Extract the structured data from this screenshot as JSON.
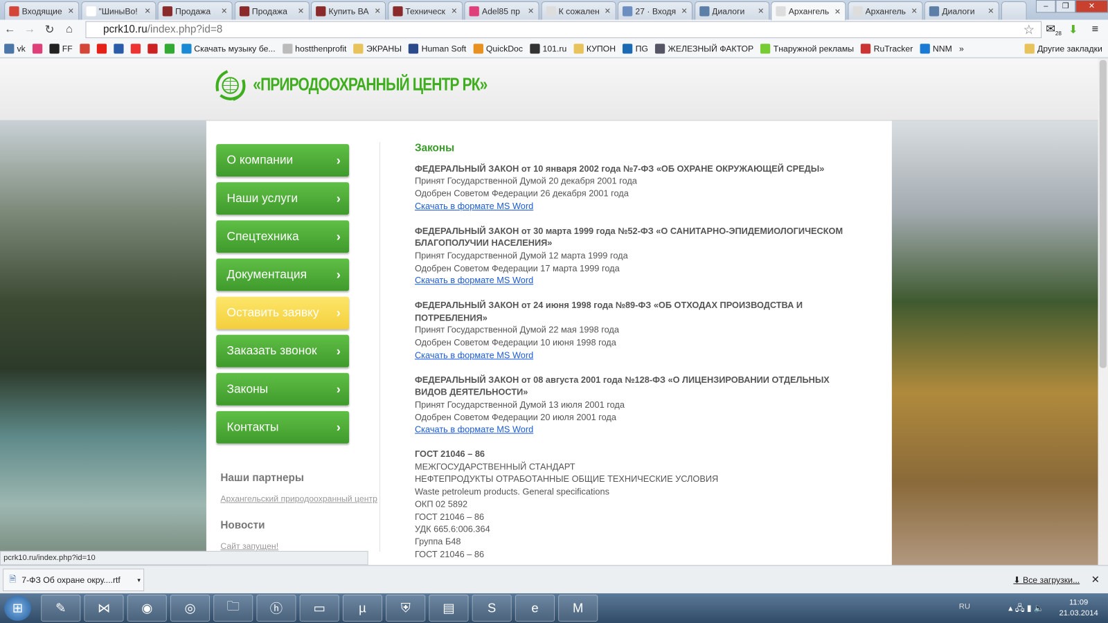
{
  "browser": {
    "tabs": [
      {
        "title": "Входящие",
        "icon": "gmail-icon",
        "color": "#d44638"
      },
      {
        "title": "\"ШиныВо!",
        "icon": "blank-page-icon",
        "color": "#ffffff"
      },
      {
        "title": "Продажа",
        "icon": "car-icon",
        "color": "#8b2a2a"
      },
      {
        "title": "Продажа",
        "icon": "car-icon",
        "color": "#8b2a2a"
      },
      {
        "title": "Купить ВА",
        "icon": "car-icon",
        "color": "#8b2a2a"
      },
      {
        "title": "Техническ",
        "icon": "car-icon",
        "color": "#8b2a2a"
      },
      {
        "title": "Adel85 пр",
        "icon": "heart-icon",
        "color": "#e0407a"
      },
      {
        "title": "К сожален",
        "icon": "page-icon",
        "color": "#dddddd"
      },
      {
        "title": "27 · Входя",
        "icon": "mail-icon",
        "color": "#6a8fc0"
      },
      {
        "title": "Диалоги",
        "icon": "vk-chat-icon",
        "color": "#5b7fa6"
      },
      {
        "title": "Архангель",
        "icon": "page-icon",
        "color": "#dddddd"
      },
      {
        "title": "Архангель",
        "icon": "page-icon",
        "color": "#dddddd"
      },
      {
        "title": "Диалоги",
        "icon": "vk-chat-icon",
        "color": "#5b7fa6"
      }
    ],
    "active_tab": 10,
    "url_host": "pcrk10.ru",
    "url_path": "/index.php?id=8",
    "mail_badge": "28",
    "bookmarks": [
      "vk",
      "",
      "FF",
      "",
      "",
      "",
      "",
      "",
      "",
      "Скачать музыку бе...",
      "hostthenprofit",
      "ЭКРАНЫ",
      "Human Soft",
      "QuickDoc",
      "101.ru",
      "КУПОН",
      "ПG",
      "ЖЕЛЕЗНЫЙ ФАКТОР",
      "Тнаружной рекламы",
      "RuTracker",
      "NNM"
    ],
    "more": "»",
    "other_bookmarks": "Другие закладки",
    "status_url": "pcrk10.ru/index.php?id=10"
  },
  "site": {
    "logo": "«ПРИРОДООХРАННЫЙ ЦЕНТР РК»",
    "menu": [
      "О компании",
      "Наши услуги",
      "Спецтехника",
      "Документация",
      "Оставить заявку",
      "Заказать звонок",
      "Законы",
      "Контакты"
    ],
    "partners_title": "Наши партнеры",
    "partner_link": "Архангельский природоохранный центр",
    "news_title": "Новости",
    "news_link": "Сайт запущен!",
    "heading": "Законы",
    "laws": [
      {
        "title": "ФЕДЕРАЛЬНЫЙ ЗАКОН от 10 января 2002 года №7-ФЗ «ОБ ОХРАНЕ ОКРУЖАЮЩЕЙ СРЕДЫ»",
        "adopted": "Принят Государственной Думой 20 декабря 2001 года",
        "approved": "Одобрен Советом Федерации 26 декабря 2001 года",
        "link": "Скачать в формате MS Word"
      },
      {
        "title": "ФЕДЕРАЛЬНЫЙ ЗАКОН от 30 марта 1999 года №52-ФЗ «О САНИТАРНО-ЭПИДЕМИОЛОГИЧЕСКОМ БЛАГОПОЛУЧИИ НАСЕЛЕНИЯ»",
        "adopted": "Принят Государственной Думой 12 марта 1999 года",
        "approved": "Одобрен Советом Федерации 17 марта 1999 года",
        "link": "Скачать в формате MS Word"
      },
      {
        "title": "ФЕДЕРАЛЬНЫЙ ЗАКОН от 24 июня 1998 года №89-ФЗ «ОБ ОТХОДАХ ПРОИЗВОДСТВА И ПОТРЕБЛЕНИЯ»",
        "adopted": "Принят Государственной Думой 22 мая 1998 года",
        "approved": "Одобрен Советом Федерации 10 июня 1998 года",
        "link": "Скачать в формате MS Word"
      },
      {
        "title": "ФЕДЕРАЛЬНЫЙ ЗАКОН от 08 августа 2001 года №128-ФЗ «О ЛИЦЕНЗИРОВАНИИ ОТДЕЛЬНЫХ ВИДОВ ДЕЯТЕЛЬНОСТИ»",
        "adopted": "Принят Государственной Думой 13 июля 2001 года",
        "approved": "Одобрен Советом Федерации 20 июля 2001 года",
        "link": "Скачать в формате MS Word"
      }
    ],
    "gost": {
      "title": "ГОСТ 21046 – 86",
      "lines": [
        "МЕЖГОСУДАРСТВЕННЫЙ СТАНДАРТ",
        "НЕФТЕПРОДУКТЫ ОТРАБОТАННЫЕ ОБЩИЕ ТЕХНИЧЕСКИЕ УСЛОВИЯ",
        "Waste petroleum products. General specifications",
        "ОКП 02 5892",
        "ГОСТ 21046 – 86",
        "УДК 665.6:006.364",
        "Группа Б48",
        "ГОСТ 21046 – 86"
      ]
    }
  },
  "downloads": {
    "file": "7-ФЗ Об охране окру....rtf",
    "all": "Все загрузки..."
  },
  "taskbar": {
    "lang": "RU",
    "time": "11:09",
    "date": "21.03.2014"
  }
}
